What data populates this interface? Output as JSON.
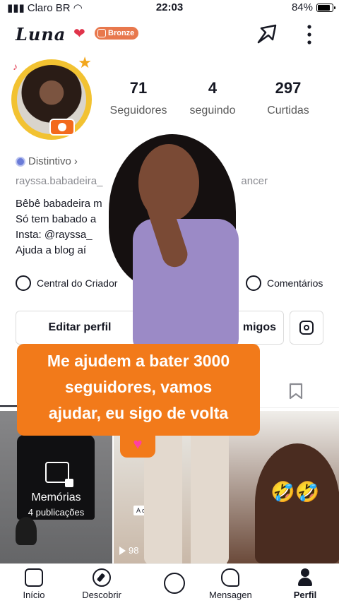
{
  "status_bar": {
    "carrier": "Claro BR",
    "time": "22:03",
    "battery": "84%",
    "battery_level": 0.84
  },
  "header": {
    "username": "Luna",
    "badge_label": "Bronze"
  },
  "stats": [
    {
      "value": "71",
      "label": "Seguidores"
    },
    {
      "value": "4",
      "label": "seguindo"
    },
    {
      "value": "297",
      "label": "Curtidas"
    }
  ],
  "profile": {
    "distintivo": "Distintivo",
    "handle_line": "rayssa.babadeira_",
    "handle_suffix": "ancer",
    "bio": [
      "Bêbê babadeira m",
      "Só tem babado a",
      "Insta: @rayssa_",
      "Ajuda a blog aí"
    ]
  },
  "actions": {
    "creator": "Central do Criador",
    "comments": "Comentários",
    "edit_profile": "Editar perfil",
    "friends": "migos"
  },
  "grid": {
    "memories_title": "Memórias",
    "memories_count": "4 publicações",
    "chip_text": "A c          ato o",
    "play_count": "98"
  },
  "overlay_caption": [
    "Me ajudem a bater 3000",
    "seguidores, vamos",
    "ajudar, eu sigo de volta"
  ],
  "bottom_nav": {
    "inicio": "Início",
    "descobrir": "Descobrir",
    "mensagens": "Mensagens",
    "perfil": "Perfil"
  },
  "colors": {
    "accent_orange": "#f27a1a",
    "bronze": "#e8784d",
    "avatar_ring": "#f2c231"
  },
  "icons": [
    "share-icon",
    "more-icon",
    "bookmark-icon",
    "instagram-icon",
    "creator-center-icon",
    "comments-icon"
  ]
}
